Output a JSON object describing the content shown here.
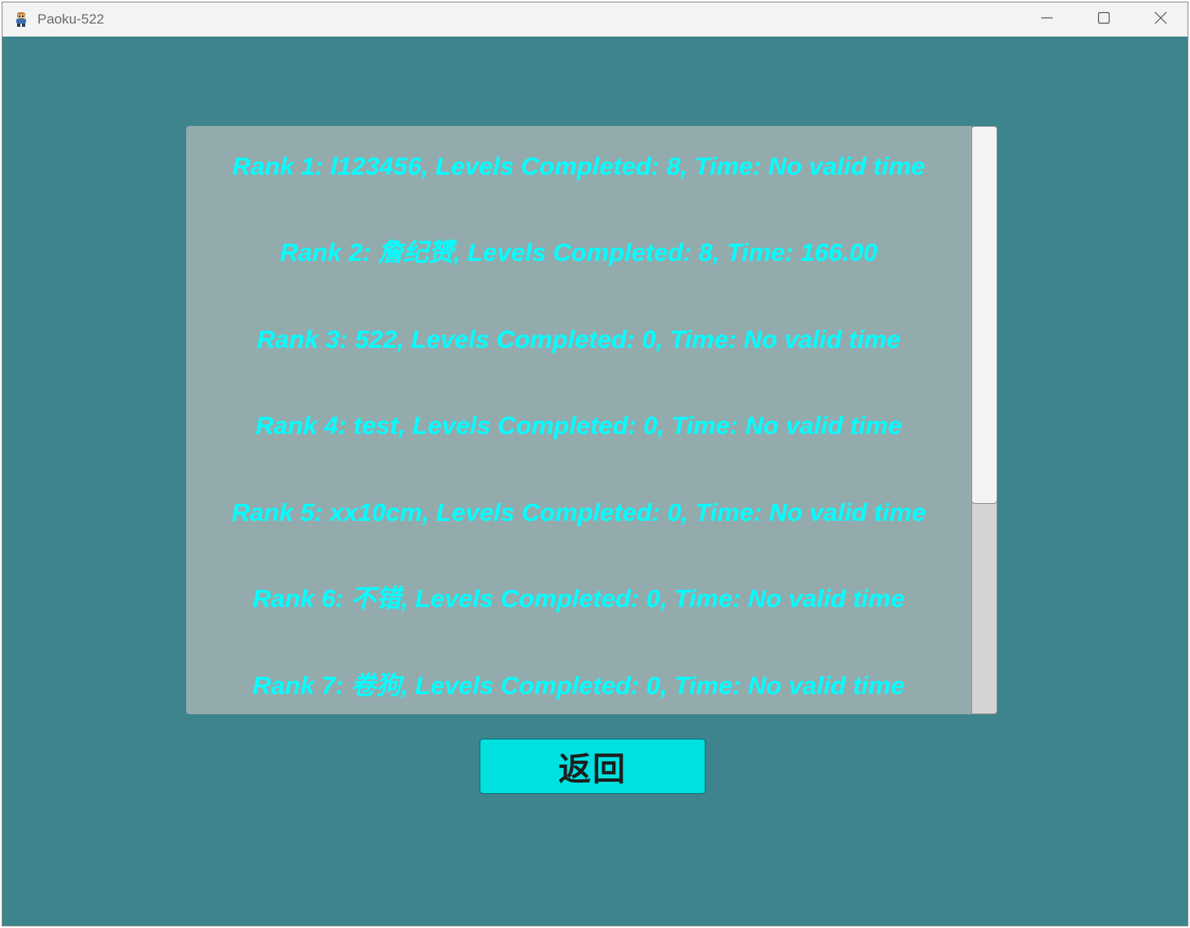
{
  "window": {
    "title": "Paoku-522",
    "app_icon": "game-character-icon",
    "controls": {
      "minimize_icon": "minimize-icon",
      "maximize_icon": "maximize-icon",
      "close_icon": "close-icon"
    }
  },
  "leaderboard": {
    "rows": [
      "Rank 1: l123456, Levels Completed: 8, Time: No valid time",
      "Rank 2: 詹纪赟, Levels Completed: 8, Time: 166.00",
      "Rank 3: 522, Levels Completed: 0, Time: No valid time",
      "Rank 4: test, Levels Completed: 0, Time: No valid time",
      "Rank 5: xx10cm, Levels Completed: 0, Time: No valid time",
      "Rank 6: 不错, Levels Completed: 0, Time: No valid time",
      "Rank 7: 卷狗, Levels Completed: 0, Time: No valid time"
    ],
    "scroll_position": 0
  },
  "back_button": {
    "label": "返回"
  },
  "colors": {
    "background": "#3d848c",
    "panel": "#94abae",
    "rank_text": "#00ffff",
    "button": "#00e0e0"
  }
}
